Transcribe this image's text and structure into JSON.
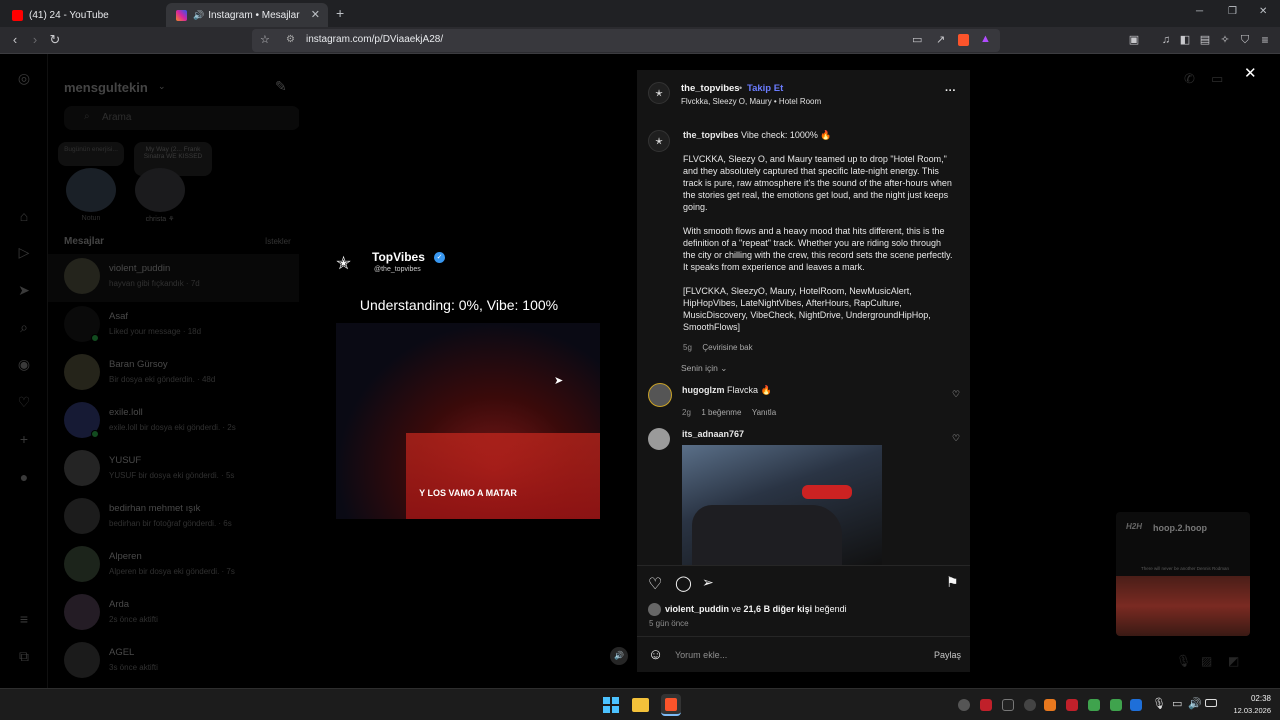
{
  "browser": {
    "tabs": [
      {
        "title": "(41) 24 - YouTube",
        "active": false
      },
      {
        "title": "Instagram • Mesajlar",
        "active": true
      }
    ],
    "url": "instagram.com/p/DViaaekjA28/",
    "new_tab": "+",
    "window": {
      "min": "─",
      "max": "❐",
      "close": "✕"
    }
  },
  "dm_sidebar": {
    "username": "mensgultekin",
    "search_placeholder": "Arama",
    "notes": [
      {
        "bubble": "Bugünün enerjisi...",
        "name": "Notun"
      },
      {
        "bubble": "My Way (2... Frank Sinatra WE KISSED",
        "name": "christa ⚘"
      }
    ],
    "messages_header": "Mesajlar",
    "requests": "İstekler",
    "conversations": [
      {
        "name": "violent_puddin",
        "sub": "hayvan gibi fıçkandık · 7d"
      },
      {
        "name": "Asaf",
        "sub": "Liked your message · 18d"
      },
      {
        "name": "Baran Gürsoy",
        "sub": "Bir dosya eki gönderdin. · 48d"
      },
      {
        "name": "exile.loll",
        "sub": "exile.loll bir dosya eki gönderdi. · 2s"
      },
      {
        "name": "YUSUF",
        "sub": "YUSUF bir dosya eki gönderdi. · 5s"
      },
      {
        "name": "bedirhan mehmet ışık",
        "sub": "bedirhan bir fotoğraf gönderdi. · 6s"
      },
      {
        "name": "Alperen",
        "sub": "Alperen bir dosya eki gönderdi. · 7s"
      },
      {
        "name": "Arda",
        "sub": "2s önce aktifti"
      },
      {
        "name": "AGEL",
        "sub": "3s önce aktifti"
      }
    ]
  },
  "floating_video": {
    "name": "hoop.2.hoop",
    "caption": "There will never be another Dennis Rodman"
  },
  "post": {
    "media": {
      "brand": "TopVibes",
      "handle": "@the_topvibes",
      "headline": "Understanding: 0%, Vibe: 100%",
      "subtitle": "Y LOS VAMO A MATAR"
    },
    "header": {
      "username": "the_topvibes",
      "follow": "Takip Et",
      "subline": "Flvckka, Sleezy O, Maury • Hotel Room",
      "more": "···"
    },
    "caption": {
      "username": "the_topvibes",
      "first_line": "Vibe check: 1000% 🔥",
      "p1": "FLVCKKA, Sleezy O, and Maury teamed up to drop \"Hotel Room,\" and they absolutely captured that specific late-night energy. This track is pure, raw atmosphere it's the sound of the after-hours when the stories get real, the emotions get loud, and the night just keeps going.",
      "p2": "With smooth flows and a heavy mood that hits different, this is the definition of a \"repeat\" track. Whether you are riding solo through the city or chilling with the crew, this record sets the scene perfectly. It speaks from experience and leaves a mark.",
      "p3": "[FLVCKKA, SleezyO, Maury, HotelRoom, NewMusicAlert, HipHopVibes, LateNightVibes, AfterHours, RapCulture, MusicDiscovery, VibeCheck, NightDrive, UndergroundHipHop, SmoothFlows]",
      "age": "5g",
      "translate": "Çevirisine bak"
    },
    "sort_label": "Senin için",
    "comments": [
      {
        "username": "hugoglzm",
        "text": "Flavcka 🔥",
        "age": "2g",
        "likes": "1 beğenme",
        "reply": "Yanıtla"
      },
      {
        "username": "its_adnaan767",
        "text": ""
      }
    ],
    "likes": {
      "user": "violent_puddin",
      "connector": "ve",
      "others": "21,6 B diğer kişi",
      "suffix": "beğendi"
    },
    "posted": "5 gün önce",
    "comment_placeholder": "Yorum ekle...",
    "share_button": "Paylaş"
  },
  "clock": {
    "time": "02:38",
    "date": "12.03.2026"
  },
  "colors": {
    "follow_blue": "#6b7cff",
    "youtube_red": "#ff0000",
    "instagram_pink": "#d6249f"
  }
}
